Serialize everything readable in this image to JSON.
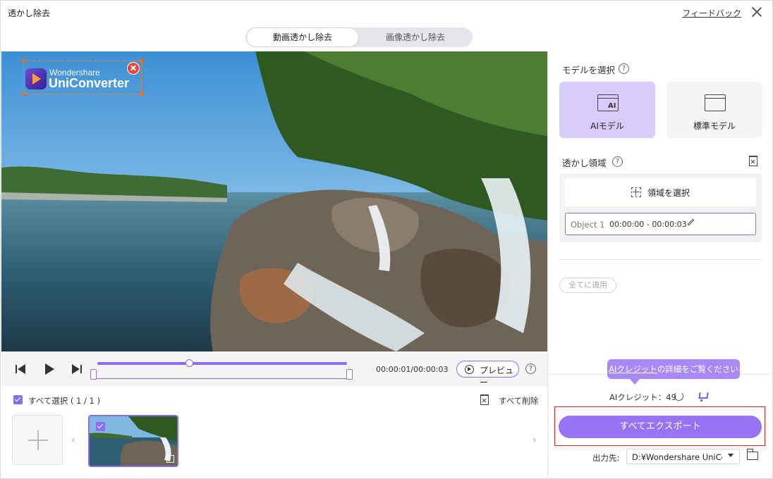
{
  "window": {
    "title": "透かし除去",
    "feedback_link": "フィードバック"
  },
  "mode_tabs": [
    {
      "label": "動画透かし除去",
      "selected": true
    },
    {
      "label": "画像透かし除去",
      "selected": false
    }
  ],
  "video": {
    "watermark_brand_top": "Wondershare",
    "watermark_brand_main": "UniConverter"
  },
  "player": {
    "timecode": "00:00:01/00:00:03",
    "preview_label": "プレビュー",
    "help_icon_glyph": "?",
    "progress_fraction": 0.37
  },
  "file_list": {
    "select_all_label": "すべて選択 ( 1 / 1 )",
    "delete_all_label": "すべて削除",
    "prev_arrow": "‹",
    "next_arrow": "›"
  },
  "right_panel": {
    "model_section_label": "モデルを選択",
    "models": [
      {
        "label": "AIモデル",
        "icon": "ai-model-icon",
        "icon_text": "AI",
        "selected": true
      },
      {
        "label": "標準モデル",
        "icon": "standard-model-icon",
        "icon_text": "",
        "selected": false
      }
    ],
    "area_section_label": "透かし領域",
    "select_area_label": "領域を選択",
    "object": {
      "name": "Object 1",
      "time_range": "00:00:00 - 00:00:03"
    },
    "apply_all_label": "全てに適用",
    "tooltip_link": "AIクレジット",
    "tooltip_rest": "の詳細をご覧ください",
    "credit_label": "AIクレジット：49",
    "export_all_label": "すべてエクスポート",
    "output_label": "出力先:",
    "output_path": "D:¥Wondershare UniConverter"
  },
  "colors": {
    "accent": "#8c6cf2",
    "export_button": "#9873f4",
    "highlight_border": "#e1251b",
    "watermark_box": "#ff7a1a"
  }
}
